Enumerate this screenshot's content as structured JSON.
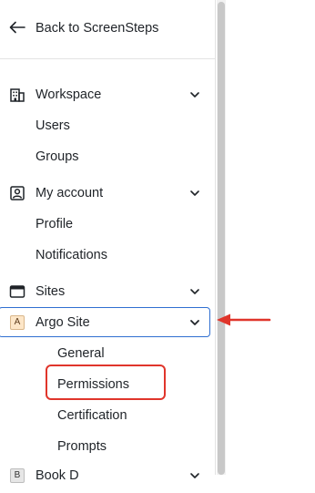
{
  "nav": {
    "back_label": "Back to ScreenSteps",
    "workspace": {
      "label": "Workspace",
      "items": [
        "Users",
        "Groups"
      ]
    },
    "my_account": {
      "label": "My account",
      "items": [
        "Profile",
        "Notifications"
      ]
    },
    "sites": {
      "label": "Sites"
    },
    "argo_site": {
      "badge": "A",
      "label": "Argo Site",
      "items": [
        "General",
        "Permissions",
        "Certification",
        "Prompts"
      ]
    },
    "next_site": {
      "badge": "B",
      "label": "Book D"
    }
  },
  "colors": {
    "focus_border": "#2f6fd1",
    "annotation": "#e0352b",
    "badge_a_bg": "#fde6c8"
  }
}
